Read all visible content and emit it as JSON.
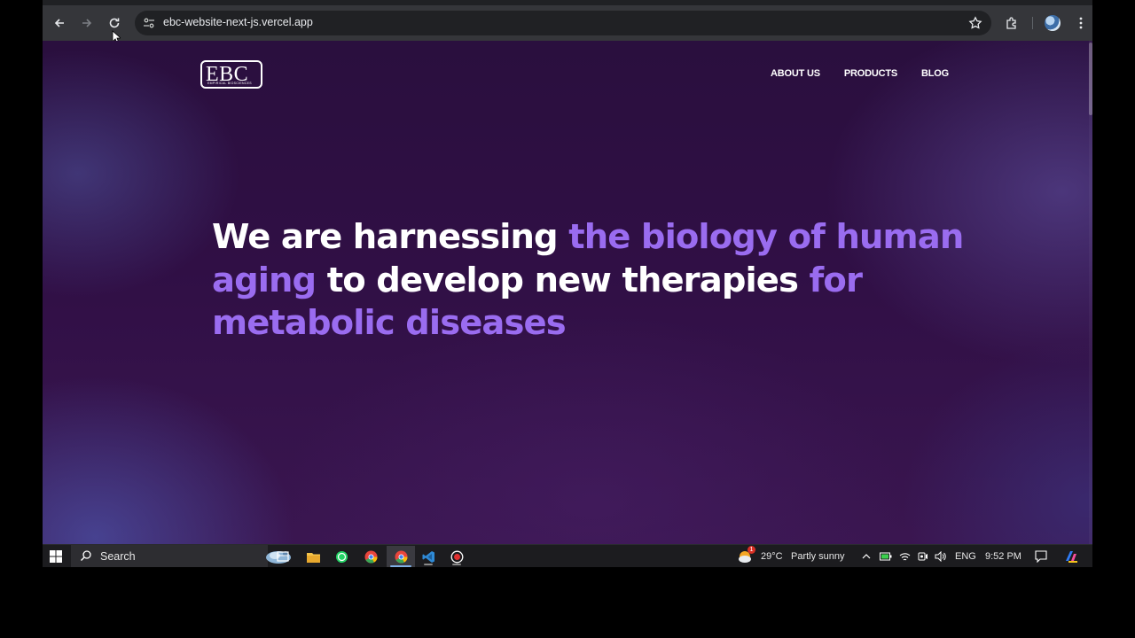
{
  "browser": {
    "url": "ebc-website-next-js.vercel.app",
    "back_label": "Back",
    "forward_label": "Forward",
    "reload_label": "Reload"
  },
  "site": {
    "logo_text": "EBC",
    "logo_subtext": "EMPIRICAL BIOSCIENCES",
    "nav": [
      "ABOUT US",
      "PRODUCTS",
      "BLOG"
    ],
    "hero": {
      "part1": "We are harnessing ",
      "part2": "the biology of human aging",
      "part3": " to develop new therapies ",
      "part4": "for metabolic diseases"
    },
    "colors": {
      "accent": "#9a6cf0",
      "background": "#2d0f42",
      "text": "#ffffff"
    }
  },
  "taskbar": {
    "search_label": "Search",
    "weather_temp": "29°C",
    "weather_desc": "Partly sunny",
    "language": "ENG",
    "time": "9:52 PM",
    "weather_badge": "1",
    "pinned_apps": [
      "task-view",
      "file-explorer",
      "whatsapp",
      "chrome",
      "chrome-active",
      "vscode",
      "recorder"
    ]
  }
}
